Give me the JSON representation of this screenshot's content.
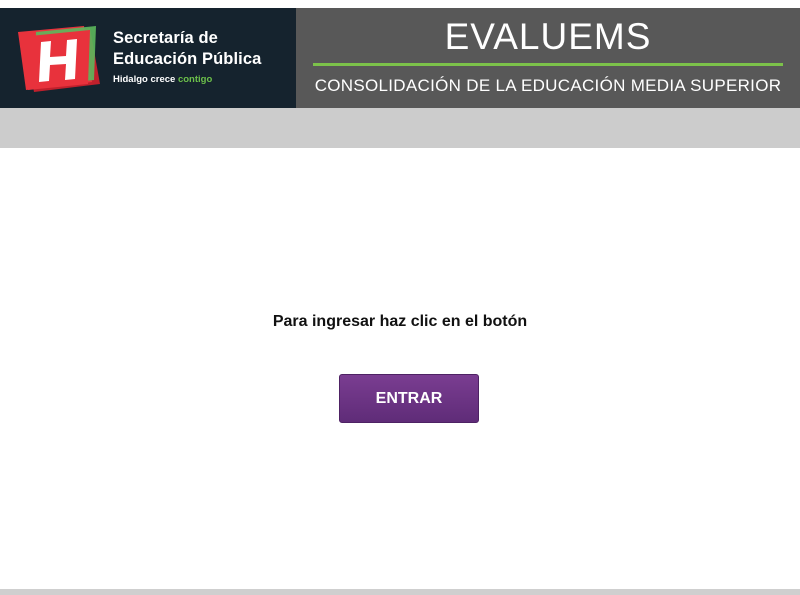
{
  "header": {
    "logo": {
      "icon": "hidalgo-h-logo-icon",
      "line1": "Secretaría de",
      "line2": "Educación Pública",
      "tagline_main": "Hidalgo crece",
      "tagline_accent": "contigo"
    },
    "title": "EVALUEMS",
    "subtitle": "CONSOLIDACIÓN DE LA EDUCACIÓN MEDIA SUPERIOR"
  },
  "main": {
    "instruction": "Para ingresar haz clic en el botón",
    "enter_button_label": "ENTRAR"
  },
  "colors": {
    "logo_background": "#15232e",
    "title_background": "#585858",
    "accent_green": "#7cc24a",
    "band_gray": "#cccccc",
    "button_purple": "#6b3585",
    "logo_red": "#e8323c"
  }
}
